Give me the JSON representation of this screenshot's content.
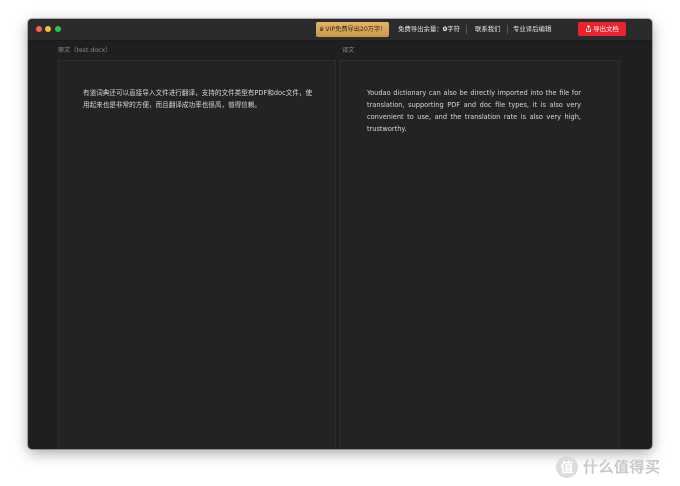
{
  "titlebar": {
    "vip_badge": "VIP免费导出20万字!",
    "quota_label": "免费导出余量：",
    "quota_value": "0",
    "quota_unit": "字符",
    "contact_label": "联系我们",
    "pro_edit_label": "专业译后编辑",
    "export_label": "导出文档"
  },
  "source_pane": {
    "label": "原文（test.docx）",
    "text": "有道词典还可以直接导入文件进行翻译，支持的文件类型有PDF和doc文件，使用起来也是非常的方便，而且翻译成功率也很高，值得信赖。"
  },
  "target_pane": {
    "label": "译文",
    "text": "Youdao dictionary can also be directly imported into the file for translation, supporting PDF and doc file types, it is also very convenient to use, and the translation rate is also very high, trustworthy."
  },
  "watermark": {
    "text": "什么值得买"
  },
  "colors": {
    "window_bg": "#1f1f21",
    "titlebar_bg": "#2b2b2e",
    "vip_gold": "#d4a85a",
    "export_red": "#e9242b"
  }
}
